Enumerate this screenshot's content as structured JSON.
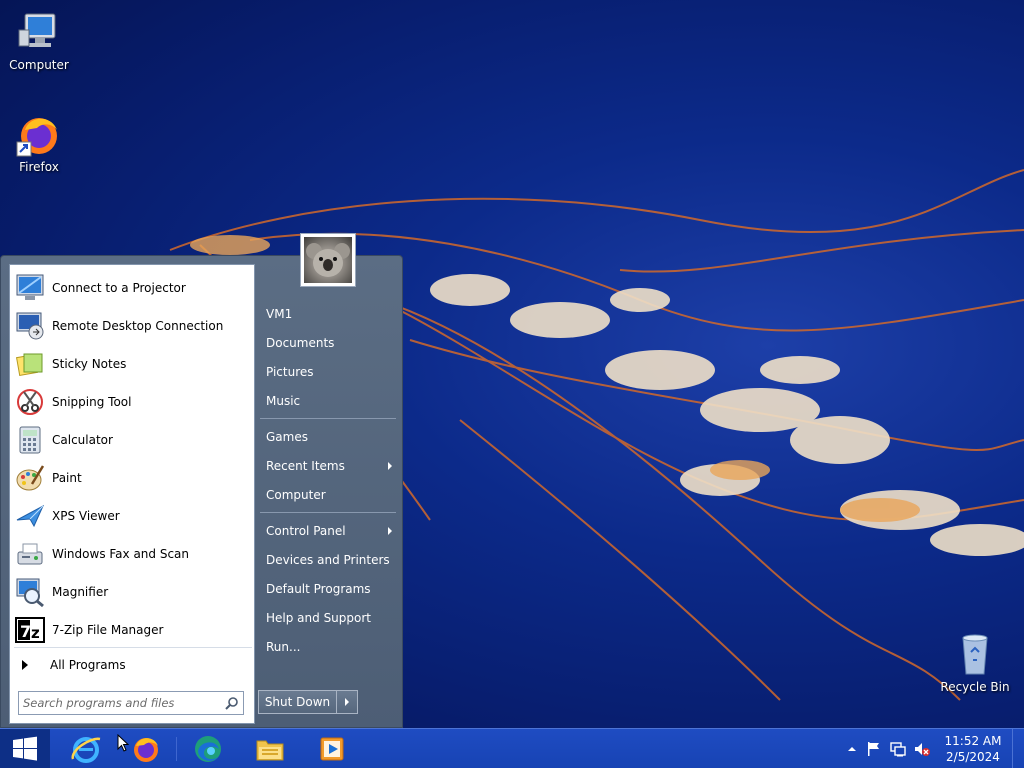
{
  "desktop": {
    "icons": [
      {
        "label": "Computer",
        "icon": "computer-icon"
      },
      {
        "label": "Firefox",
        "icon": "firefox-icon"
      },
      {
        "label": "Recycle Bin",
        "icon": "recycle-bin-icon"
      }
    ]
  },
  "start_menu": {
    "programs": [
      {
        "label": "Connect to a Projector",
        "icon": "projector-icon"
      },
      {
        "label": "Remote Desktop Connection",
        "icon": "remote-desktop-icon"
      },
      {
        "label": "Sticky Notes",
        "icon": "sticky-notes-icon"
      },
      {
        "label": "Snipping Tool",
        "icon": "snipping-tool-icon"
      },
      {
        "label": "Calculator",
        "icon": "calculator-icon"
      },
      {
        "label": "Paint",
        "icon": "paint-icon"
      },
      {
        "label": "XPS Viewer",
        "icon": "xps-viewer-icon"
      },
      {
        "label": "Windows Fax and Scan",
        "icon": "fax-scan-icon"
      },
      {
        "label": "Magnifier",
        "icon": "magnifier-icon"
      },
      {
        "label": "7-Zip File Manager",
        "icon": "7zip-icon"
      }
    ],
    "all_programs": "All Programs",
    "search_placeholder": "Search programs and files",
    "right_items": [
      {
        "label": "VM1"
      },
      {
        "label": "Documents"
      },
      {
        "label": "Pictures"
      },
      {
        "label": "Music"
      },
      {
        "label": "Games"
      },
      {
        "label": "Recent Items",
        "submenu": true
      },
      {
        "label": "Computer"
      },
      {
        "label": "Control Panel",
        "submenu": true
      },
      {
        "label": "Devices and Printers"
      },
      {
        "label": "Default Programs"
      },
      {
        "label": "Help and Support"
      },
      {
        "label": "Run..."
      }
    ],
    "shutdown_label": "Shut Down"
  },
  "taskbar": {
    "pinned": [
      "internet-explorer-icon",
      "firefox-icon",
      "edge-icon",
      "file-explorer-icon",
      "media-player-icon"
    ],
    "tray_icons": [
      "show-hidden-icons-arrow",
      "action-center-flag-icon",
      "network-icon",
      "volume-muted-icon"
    ],
    "time": "11:52 AM",
    "date": "2/5/2024"
  },
  "colors": {
    "taskbar": "#1743b4",
    "start_menu_right": "#56677d",
    "desktop": "#0c2a8a"
  }
}
